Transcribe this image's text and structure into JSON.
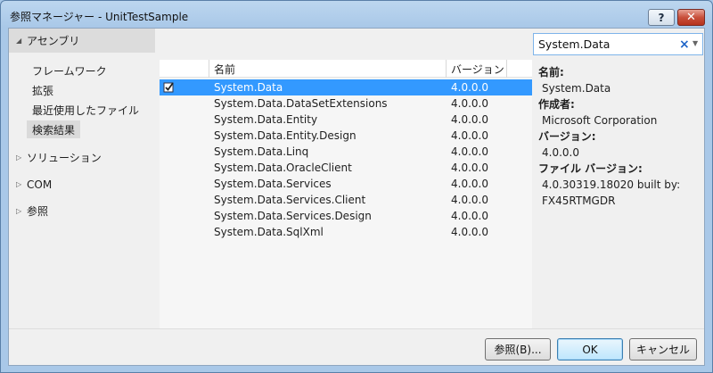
{
  "window": {
    "title": "参照マネージャー - UnitTestSample",
    "help_label": "?",
    "close_label": "✕"
  },
  "nav": {
    "assemblies": "アセンブリ",
    "items": [
      {
        "label": "フレームワーク"
      },
      {
        "label": "拡張"
      },
      {
        "label": "最近使用したファイル"
      },
      {
        "label": "検索結果"
      }
    ],
    "solution": "ソリューション",
    "com": "COM",
    "browse": "参照"
  },
  "search": {
    "value": "System.Data",
    "clear_icon": "clear-icon"
  },
  "list": {
    "columns": {
      "name": "名前",
      "version": "バージョン"
    },
    "rows": [
      {
        "name": "System.Data",
        "version": "4.0.0.0",
        "selected": true
      },
      {
        "name": "System.Data.DataSetExtensions",
        "version": "4.0.0.0"
      },
      {
        "name": "System.Data.Entity",
        "version": "4.0.0.0"
      },
      {
        "name": "System.Data.Entity.Design",
        "version": "4.0.0.0"
      },
      {
        "name": "System.Data.Linq",
        "version": "4.0.0.0"
      },
      {
        "name": "System.Data.OracleClient",
        "version": "4.0.0.0"
      },
      {
        "name": "System.Data.Services",
        "version": "4.0.0.0"
      },
      {
        "name": "System.Data.Services.Client",
        "version": "4.0.0.0"
      },
      {
        "name": "System.Data.Services.Design",
        "version": "4.0.0.0"
      },
      {
        "name": "System.Data.SqlXml",
        "version": "4.0.0.0"
      }
    ]
  },
  "detail": {
    "name_label": "名前:",
    "name": "System.Data",
    "author_label": "作成者:",
    "author": "Microsoft Corporation",
    "version_label": "バージョン:",
    "version": "4.0.0.0",
    "file_version_label": "ファイル バージョン:",
    "file_version_line1": "4.0.30319.18020 built by:",
    "file_version_line2": "FX45RTMGDR"
  },
  "buttons": {
    "browse": "参照(B)...",
    "ok": "OK",
    "cancel": "キャンセル"
  },
  "colors": {
    "selection": "#3399ff",
    "title_bar": "#a9c8e8",
    "close": "#c8503c"
  }
}
